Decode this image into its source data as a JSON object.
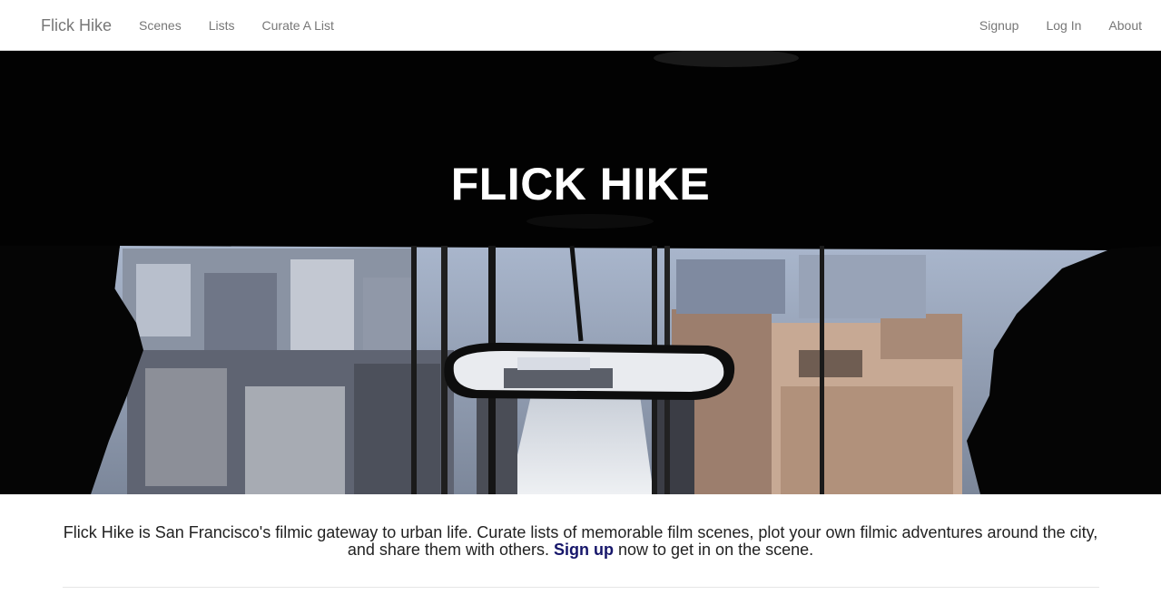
{
  "nav": {
    "brand": "Flick Hike",
    "left_links": [
      "Scenes",
      "Lists",
      "Curate A List"
    ],
    "right_links": [
      "Signup",
      "Log In",
      "About"
    ]
  },
  "hero": {
    "title": "FLICK HIKE"
  },
  "intro": {
    "text_before": "Flick Hike is San Francisco's filmic gateway to urban life. Curate lists of memorable film scenes, plot your own filmic adventures around the city, and share them with others. ",
    "link_text": "Sign up",
    "text_after": " now to get in on the scene."
  },
  "colors": {
    "nav_text": "#777777",
    "link": "#16166a",
    "hero_bg": "#020202"
  }
}
